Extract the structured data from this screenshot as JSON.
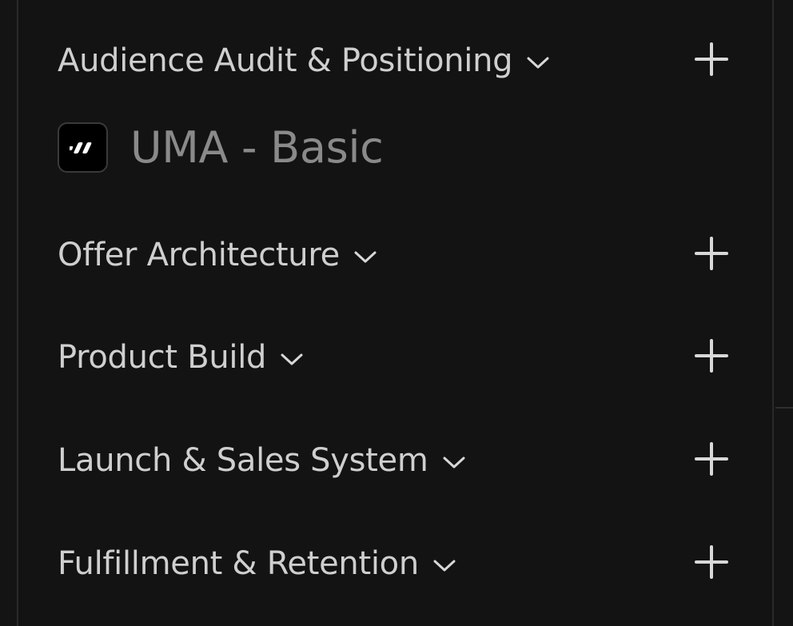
{
  "sections": [
    {
      "label": "Audience Audit & Positioning",
      "chevron_icon": "chevron-down-icon",
      "add_icon": "plus-icon"
    },
    {
      "label": "Offer Architecture",
      "chevron_icon": "chevron-down-icon",
      "add_icon": "plus-icon"
    },
    {
      "label": "Product Build",
      "chevron_icon": "chevron-down-icon",
      "add_icon": "plus-icon"
    },
    {
      "label": "Launch & Sales System",
      "chevron_icon": "chevron-down-icon",
      "add_icon": "plus-icon"
    },
    {
      "label": "Fulfillment & Retention",
      "chevron_icon": "chevron-down-icon",
      "add_icon": "plus-icon"
    }
  ],
  "items": [
    {
      "label": "UMA - Basic",
      "icon": "app-logo-icon"
    }
  ],
  "colors": {
    "background": "#111111",
    "section_text": "#cfcfcf",
    "item_text": "#8a8a8a",
    "icon_stroke": "#d8d8d8"
  }
}
